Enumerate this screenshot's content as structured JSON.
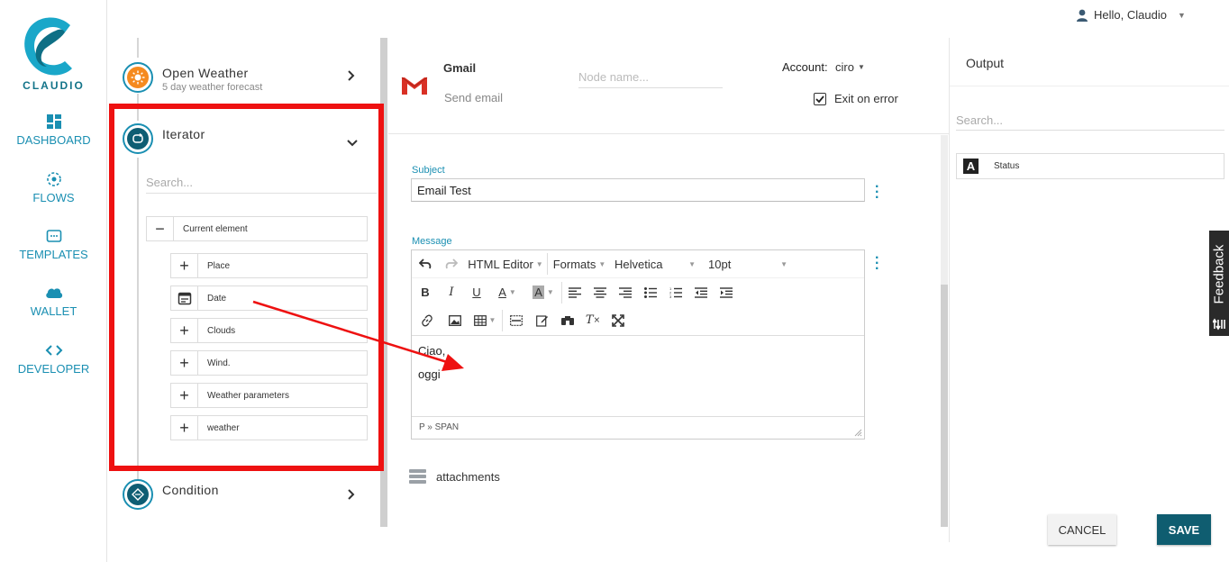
{
  "brand": {
    "name": "CLAUDIO",
    "color": "#137489"
  },
  "nav": {
    "items": [
      {
        "label": "DASHBOARD",
        "icon": "dashboard-icon"
      },
      {
        "label": "FLOWS",
        "icon": "flows-icon"
      },
      {
        "label": "TEMPLATES",
        "icon": "templates-icon"
      },
      {
        "label": "WALLET",
        "icon": "cloud-icon"
      },
      {
        "label": "DEVELOPER",
        "icon": "code-icon"
      }
    ]
  },
  "user": {
    "greeting": "Hello, Claudio"
  },
  "flow": {
    "nodes": {
      "open_weather": {
        "title": "Open Weather",
        "subtitle": "5 day weather forecast"
      },
      "iterator": {
        "title": "Iterator",
        "search_placeholder": "Search..."
      },
      "condition": {
        "title": "Condition"
      }
    },
    "tree": {
      "root": "Current element",
      "children": [
        "Place",
        "Date",
        "Clouds",
        "Wind.",
        "Weather parameters",
        "weather"
      ]
    }
  },
  "node_editor": {
    "service": "Gmail",
    "action": "Send email",
    "node_name_placeholder": "Node name...",
    "account_label": "Account:",
    "account_value": "ciro",
    "exit_on_error_label": "Exit on error",
    "exit_on_error": true,
    "subject_label": "Subject",
    "subject_value": "Email Test",
    "message_label": "Message",
    "toolbar": {
      "html_editor": "HTML Editor",
      "formats": "Formats",
      "font": "Helvetica",
      "size": "10pt"
    },
    "message_lines": [
      "Ciao,",
      "oggi"
    ],
    "path": "P » SPAN",
    "attachments_label": "attachments"
  },
  "output": {
    "title": "Output",
    "search_placeholder": "Search...",
    "items": [
      {
        "type_badge": "A",
        "label": "Status"
      }
    ]
  },
  "actions": {
    "cancel": "CANCEL",
    "save": "SAVE"
  },
  "feedback": {
    "label": "Feedback"
  }
}
